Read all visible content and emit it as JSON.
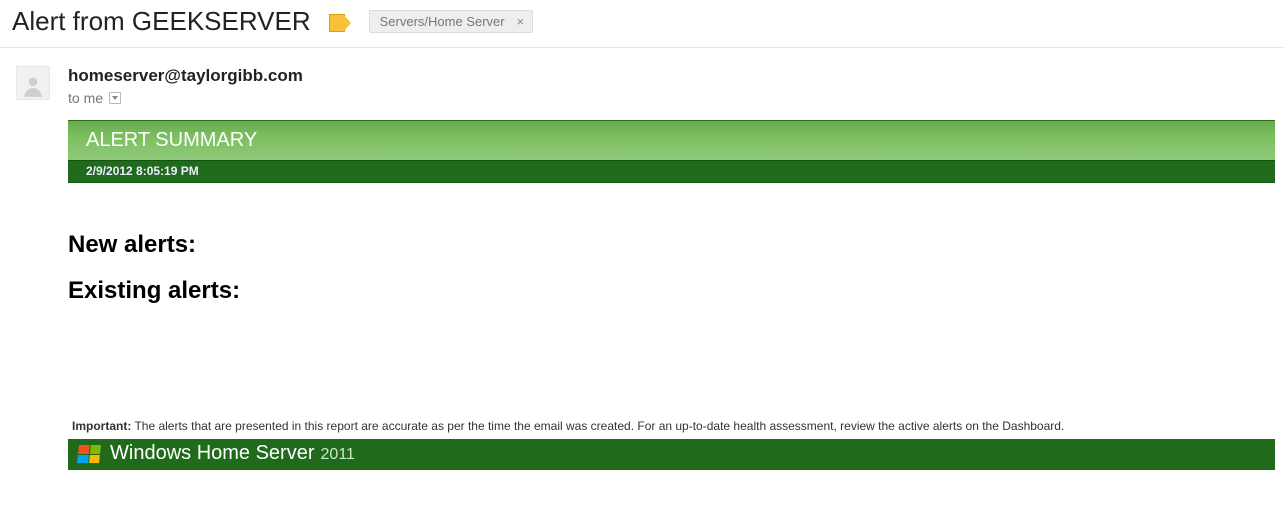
{
  "header": {
    "subject": "Alert from GEEKSERVER",
    "chip_label": "Servers/Home Server"
  },
  "message": {
    "from": "homeserver@taylorgibb.com",
    "to_line": "to me"
  },
  "alert": {
    "summary_title": "ALERT SUMMARY",
    "timestamp": "2/9/2012 8:05:19 PM",
    "sections": {
      "new_alerts": "New alerts:",
      "existing_alerts": "Existing alerts:"
    }
  },
  "footer": {
    "disclaimer_bold": "Important:",
    "disclaimer_text": " The alerts that are presented in this report are accurate as per the time the email was created. For an up-to-date health assessment, review the active alerts on the Dashboard.",
    "brand_name": "Windows Home Server",
    "brand_year": "2011"
  }
}
